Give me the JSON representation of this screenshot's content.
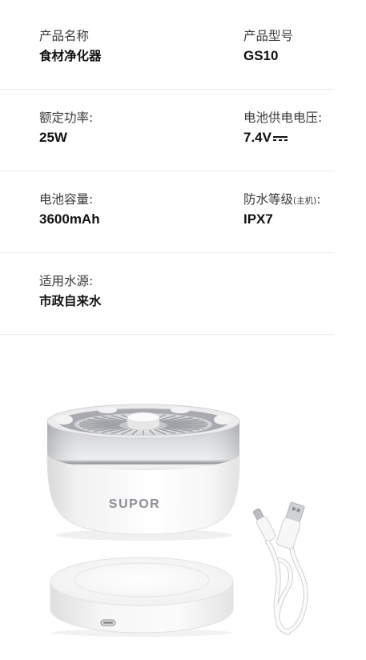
{
  "specs": [
    {
      "label": "产品名称",
      "value": "食材净化器"
    },
    {
      "label": "产品型号",
      "value": "GS10"
    },
    {
      "label": "额定功率:",
      "value": "25W"
    },
    {
      "label": "电池供电电压:",
      "value": "7.4V",
      "value_icon": "dc-symbol-icon"
    },
    {
      "label": "电池容量:",
      "value": "3600mAh"
    },
    {
      "label": "防水等级",
      "label_note": "(主机)",
      "label_colon": ":",
      "value": "IPX7"
    },
    {
      "label": "适用水源:",
      "value": "市政自来水"
    }
  ],
  "product_image": {
    "brand_logo_text": "SUPOR",
    "items": [
      "food-purifier-main-unit-icon",
      "charging-base-icon",
      "usb-cable-icon"
    ]
  },
  "colors": {
    "label": "#3a3a3a",
    "value": "#111111",
    "divider": "#ececec",
    "logo": "#8b8e93"
  }
}
